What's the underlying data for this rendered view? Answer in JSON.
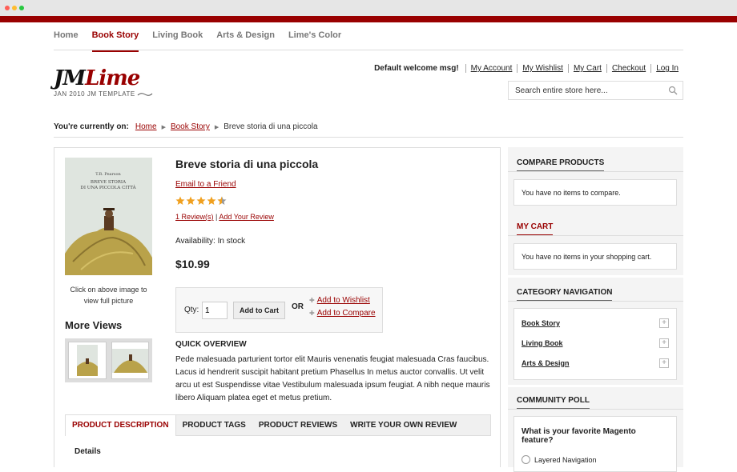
{
  "topnav": [
    {
      "label": "Home",
      "active": false
    },
    {
      "label": "Book Story",
      "active": true
    },
    {
      "label": "Living Book",
      "active": false
    },
    {
      "label": "Arts & Design",
      "active": false
    },
    {
      "label": "Lime's Color",
      "active": false
    }
  ],
  "logo": {
    "part1": "JM",
    "part2": "Lime",
    "tagline": "JAN 2010  JM TEMPLATE"
  },
  "header": {
    "welcome": "Default welcome msg!",
    "links": [
      "My Account",
      "My Wishlist",
      "My Cart",
      "Checkout",
      "Log In"
    ],
    "search_placeholder": "Search entire store here..."
  },
  "breadcrumb": {
    "label": "You're currently on:",
    "home": "Home",
    "category": "Book Story",
    "current": "Breve storia di una piccola"
  },
  "product": {
    "title": "Breve storia di una piccola",
    "email_link": "Email to a Friend",
    "rating": 4.5,
    "reviews_link": "1 Review(s)",
    "add_review_link": "Add Your Review",
    "review_sep": "|",
    "availability": "Availability: In stock",
    "price": "$10.99",
    "qty_label": "Qty:",
    "qty_value": "1",
    "add_to_cart": "Add to Cart",
    "or": "OR",
    "wishlist_link": "Add to Wishlist",
    "compare_link": "Add to Compare",
    "image_hint_1": "Click on above image to",
    "image_hint_2": "view full picture",
    "cover_author": "T.R. Pearson",
    "cover_title_1": "BREVE STORIA",
    "cover_title_2": "DI UNA PICCOLA CITTÀ",
    "more_views": "More Views",
    "quick_overview_title": "QUICK OVERVIEW",
    "quick_overview": "Pede malesuada parturient tortor elit Mauris venenatis feugiat malesuada Cras faucibus. Lacus id hendrerit suscipit habitant pretium Phasellus In metus auctor convallis. Ut velit arcu ut est Suspendisse vitae Vestibulum malesuada ipsum feugiat. A nibh neque mauris libero Aliquam platea eget et metus pretium."
  },
  "tabs": [
    {
      "label": "PRODUCT DESCRIPTION",
      "active": true
    },
    {
      "label": "PRODUCT TAGS",
      "active": false
    },
    {
      "label": "PRODUCT REVIEWS",
      "active": false
    },
    {
      "label": "WRITE YOUR OWN REVIEW",
      "active": false
    }
  ],
  "details_heading": "Details",
  "sidebar": {
    "compare": {
      "title": "COMPARE PRODUCTS",
      "message": "You have no items to compare."
    },
    "cart": {
      "title": "MY CART",
      "message": "You have no items in your shopping cart."
    },
    "categories": {
      "title": "CATEGORY NAVIGATION",
      "items": [
        "Book Story",
        "Living Book",
        "Arts & Design"
      ]
    },
    "poll": {
      "title": "COMMUNITY POLL",
      "question": "What is your favorite Magento feature?",
      "options": [
        "Layered Navigation"
      ]
    }
  },
  "colors": {
    "brand": "#990000",
    "star": "#f0a020"
  }
}
